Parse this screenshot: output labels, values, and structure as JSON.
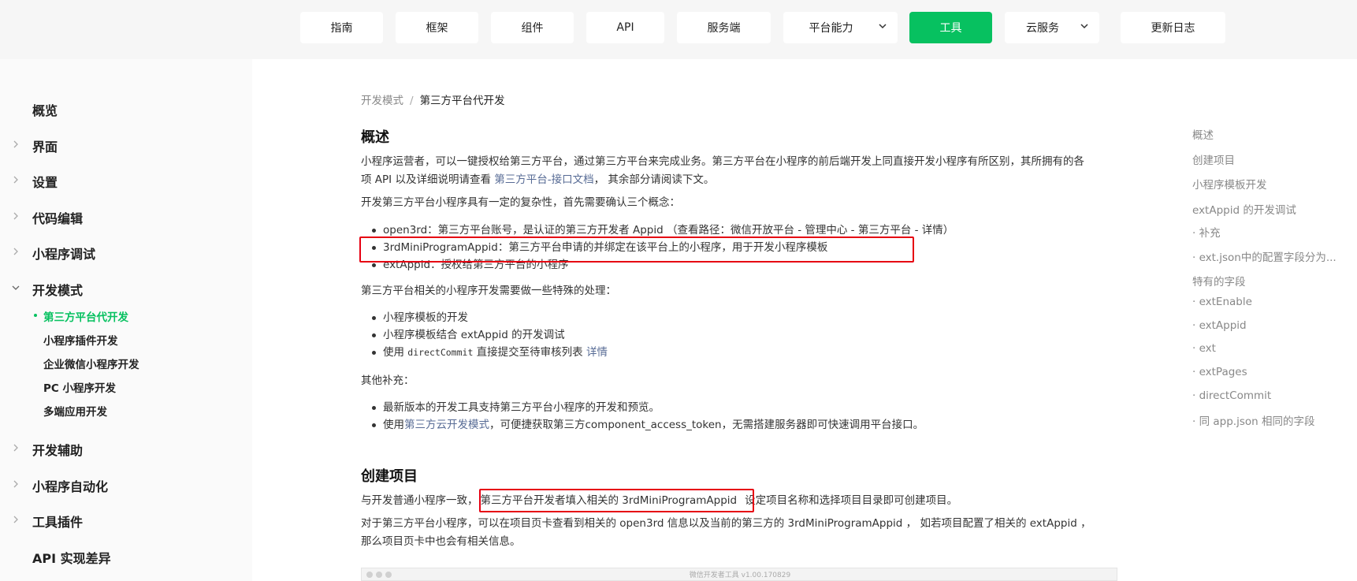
{
  "nav": {
    "items": [
      {
        "label": "指南"
      },
      {
        "label": "框架"
      },
      {
        "label": "组件"
      },
      {
        "label": "API"
      },
      {
        "label": "服务端"
      },
      {
        "label": "平台能力"
      },
      {
        "label": "工具"
      },
      {
        "label": "云服务"
      },
      {
        "label": "更新日志"
      }
    ],
    "active_color": "#07c160"
  },
  "sidebar": {
    "items": [
      {
        "label": "概览"
      },
      {
        "label": "界面"
      },
      {
        "label": "设置"
      },
      {
        "label": "代码编辑"
      },
      {
        "label": "小程序调试"
      },
      {
        "label": "开发模式"
      },
      {
        "label": "开发辅助"
      },
      {
        "label": "小程序自动化"
      },
      {
        "label": "工具插件"
      },
      {
        "label": "API 实现差异"
      }
    ],
    "sub_items": [
      {
        "label": "第三方平台代开发"
      },
      {
        "label": "小程序插件开发"
      },
      {
        "label": "企业微信小程序开发"
      },
      {
        "label": "PC 小程序开发"
      },
      {
        "label": "多端应用开发"
      }
    ]
  },
  "breadcrumb": {
    "parent": "开发模式",
    "separator": "/",
    "current": "第三方平台代开发"
  },
  "section1": {
    "title": "概述",
    "p1_line1": "小程序运营者，可以一键授权给第三方平台，通过第三方平台来完成业务。第三方平台在小程序的前后端开发上同直接开发小程序有所区别，其所拥有的各",
    "p1_line2_pre": "项 API 以及详细说明请查看 ",
    "p1_link": "第三方平台-接口文档",
    "p1_line2_post": "， 其余部分请阅读下文。",
    "p2": "开发第三方平台小程序具有一定的复杂性，首先需要确认三个概念：",
    "concepts": [
      "open3rd：第三方平台账号，是认证的第三方开发者 Appid （查看路径：微信开放平台 - 管理中心 - 第三方平台 - 详情）",
      "3rdMiniProgramAppid：第三方平台申请的并绑定在该平台上的小程序，用于开发小程序模板",
      "extAppid：授权给第三方平台的小程序"
    ],
    "p3": "第三方平台相关的小程序开发需要做一些特殊的处理：",
    "special": [
      "小程序模板的开发",
      "小程序模板结合 extAppid 的开发调试"
    ],
    "special3_pre": "使用 ",
    "special3_code": "directCommit",
    "special3_mid": " 直接提交至待审核列表 ",
    "special3_link": "详情",
    "p4": "其他补充：",
    "extra1": "最新版本的开发工具支持第三方平台小程序的开发和预览。",
    "extra2_pre": "使用",
    "extra2_link": "第三方云开发模式",
    "extra2_post": "，可便捷获取第三方component_access_token，无需搭建服务器即可快速调用平台接口。"
  },
  "section2": {
    "title": "创建项目",
    "p1_pre": "与开发普通小程序一致，",
    "p1_highlight": "第三方平台开发者填入相关的 3rdMiniProgramAppid",
    "p1_post": "设定项目名称和选择项目目录即可创建项目。",
    "p2_line1": "对于第三方平台小程序，可以在项目页卡查看到相关的 open3rd 信息以及当前的第三方的 3rdMiniProgramAppid ， 如若项目配置了相关的 extAppid ，",
    "p2_line2": "那么项目页卡中也会有相关信息。"
  },
  "embedded_screenshot_title": "微信开发者工具 v1.00.170829",
  "toc": [
    {
      "label": "概述"
    },
    {
      "label": "创建项目"
    },
    {
      "label": "小程序模板开发"
    },
    {
      "label": "extAppid 的开发调试"
    },
    {
      "label": "· 补充"
    },
    {
      "label": "· ext.json中的配置字段分为..."
    },
    {
      "label": "特有的字段"
    },
    {
      "label": "· extEnable"
    },
    {
      "label": "· extAppid"
    },
    {
      "label": "· ext"
    },
    {
      "label": "· extPages"
    },
    {
      "label": "· directCommit"
    },
    {
      "label": "· 同 app.json 相同的字段"
    }
  ],
  "colors": {
    "highlight_border": "#e60012",
    "link": "#576b95",
    "accent": "#07c160"
  }
}
